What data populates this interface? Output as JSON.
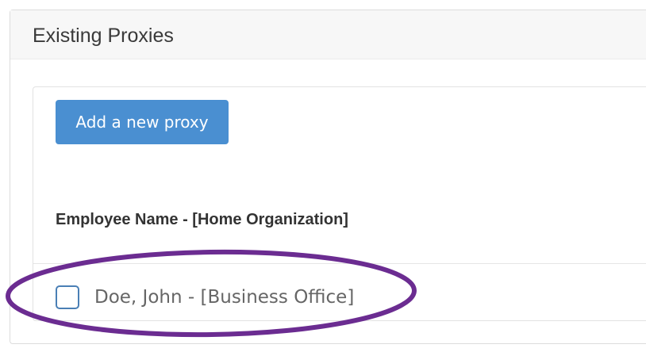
{
  "panel": {
    "title": "Existing Proxies"
  },
  "toolbar": {
    "add_label": "Add a new proxy"
  },
  "list": {
    "header": "Employee Name - [Home Organization]",
    "items": [
      {
        "label": "Doe, John - [Business Office]",
        "checked": false
      }
    ]
  },
  "colors": {
    "accent": "#4a8fd1",
    "annotation": "#6b2c91"
  }
}
